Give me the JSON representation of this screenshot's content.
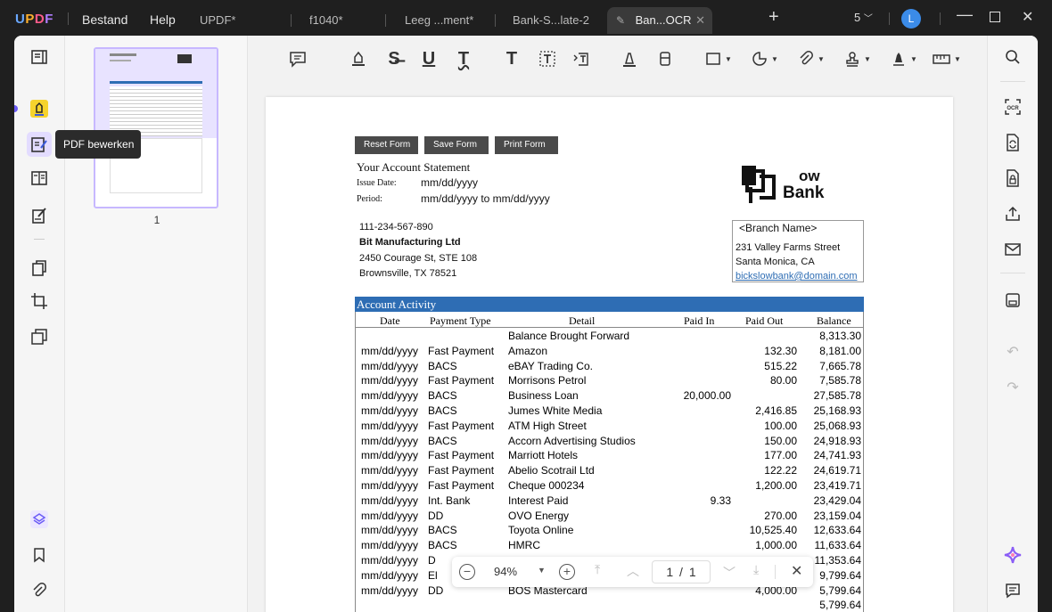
{
  "titlebar": {
    "logo": "UPDF",
    "menu": [
      "Bestand",
      "Help"
    ],
    "tabs": [
      {
        "label": "UPDF*",
        "active": false
      },
      {
        "label": "f1040*",
        "active": false
      },
      {
        "label": "Leeg ...ment*",
        "active": false
      },
      {
        "label": "Bank-S...late-2",
        "active": false
      },
      {
        "label": "Ban...OCR",
        "active": true
      }
    ],
    "tab_count": "5",
    "avatar": "L"
  },
  "tooltip": "PDF bewerken",
  "thumbnail": {
    "page_label": "1"
  },
  "findbar": {
    "zoom": "94%",
    "page_current": "1",
    "page_sep": "/",
    "page_total": "1"
  },
  "doc": {
    "form_buttons": [
      "Reset Form",
      "Save Form",
      "Print Form"
    ],
    "statement_title": "Your Account Statement",
    "issue_label": "Issue Date:",
    "issue_value": "mm/dd/yyyy",
    "period_label": "Period:",
    "period_value": "mm/dd/yyyy to mm/dd/yyyy",
    "bank_logo_text": "ow",
    "bank_logo_text2": "Bank",
    "phone": "111-234-567-890",
    "company": "Bit Manufacturing Ltd",
    "address1": "2450 Courage St, STE 108",
    "address2": "Brownsville, TX 78521",
    "branch_name": "<Branch Name>",
    "branch_addr1": "231 Valley Farms Street",
    "branch_addr2": "Santa Monica, CA",
    "branch_email": "bickslowbank@domain.com",
    "activity_title": "Account Activity",
    "columns": [
      "Date",
      "Payment Type",
      "Detail",
      "Paid In",
      "Paid Out",
      "Balance"
    ],
    "rows": [
      {
        "date": "",
        "type": "",
        "detail": "Balance Brought Forward",
        "in": "",
        "out": "",
        "bal": "8,313.30"
      },
      {
        "date": "mm/dd/yyyy",
        "type": "Fast Payment",
        "detail": "Amazon",
        "in": "",
        "out": "132.30",
        "bal": "8,181.00"
      },
      {
        "date": "mm/dd/yyyy",
        "type": "BACS",
        "detail": "eBAY Trading Co.",
        "in": "",
        "out": "515.22",
        "bal": "7,665.78"
      },
      {
        "date": "mm/dd/yyyy",
        "type": "Fast Payment",
        "detail": "Morrisons Petrol",
        "in": "",
        "out": "80.00",
        "bal": "7,585.78"
      },
      {
        "date": "mm/dd/yyyy",
        "type": "BACS",
        "detail": "Business Loan",
        "in": "20,000.00",
        "out": "",
        "bal": "27,585.78"
      },
      {
        "date": "mm/dd/yyyy",
        "type": "BACS",
        "detail": "Jumes White Media",
        "in": "",
        "out": "2,416.85",
        "bal": "25,168.93"
      },
      {
        "date": "mm/dd/yyyy",
        "type": "Fast Payment",
        "detail": "ATM High Street",
        "in": "",
        "out": "100.00",
        "bal": "25,068.93"
      },
      {
        "date": "mm/dd/yyyy",
        "type": "BACS",
        "detail": "Accorn Advertising Studios",
        "in": "",
        "out": "150.00",
        "bal": "24,918.93"
      },
      {
        "date": "mm/dd/yyyy",
        "type": "Fast Payment",
        "detail": "Marriott Hotels",
        "in": "",
        "out": "177.00",
        "bal": "24,741.93"
      },
      {
        "date": "mm/dd/yyyy",
        "type": "Fast Payment",
        "detail": "Abelio Scotrail Ltd",
        "in": "",
        "out": "122.22",
        "bal": "24,619.71"
      },
      {
        "date": "mm/dd/yyyy",
        "type": "Fast Payment",
        "detail": "Cheque 000234",
        "in": "",
        "out": "1,200.00",
        "bal": "23,419.71"
      },
      {
        "date": "mm/dd/yyyy",
        "type": "Int. Bank",
        "detail": "Interest Paid",
        "in": "9.33",
        "out": "",
        "bal": "23,429.04"
      },
      {
        "date": "mm/dd/yyyy",
        "type": "DD",
        "detail": "OVO Energy",
        "in": "",
        "out": "270.00",
        "bal": "23,159.04"
      },
      {
        "date": "mm/dd/yyyy",
        "type": "BACS",
        "detail": "Toyota Online",
        "in": "",
        "out": "10,525.40",
        "bal": "12,633.64"
      },
      {
        "date": "mm/dd/yyyy",
        "type": "BACS",
        "detail": "HMRC",
        "in": "",
        "out": "1,000.00",
        "bal": "11,633.64"
      },
      {
        "date": "mm/dd/yyyy",
        "type": "D",
        "detail": "",
        "in": "",
        "out": "",
        "bal": "11,353.64"
      },
      {
        "date": "mm/dd/yyyy",
        "type": "El",
        "detail": "",
        "in": "",
        "out": "",
        "bal": "9,799.64"
      },
      {
        "date": "mm/dd/yyyy",
        "type": "DD",
        "detail": "BOS Mastercard",
        "in": "",
        "out": "4,000.00",
        "bal": "5,799.64"
      },
      {
        "date": "",
        "type": "",
        "detail": "",
        "in": "",
        "out": "",
        "bal": "5,799.64"
      }
    ]
  },
  "colors": {
    "accent": "#2e6db4",
    "brand_purple": "#8a5cf6",
    "sidebar_active": "#e3dcff"
  }
}
